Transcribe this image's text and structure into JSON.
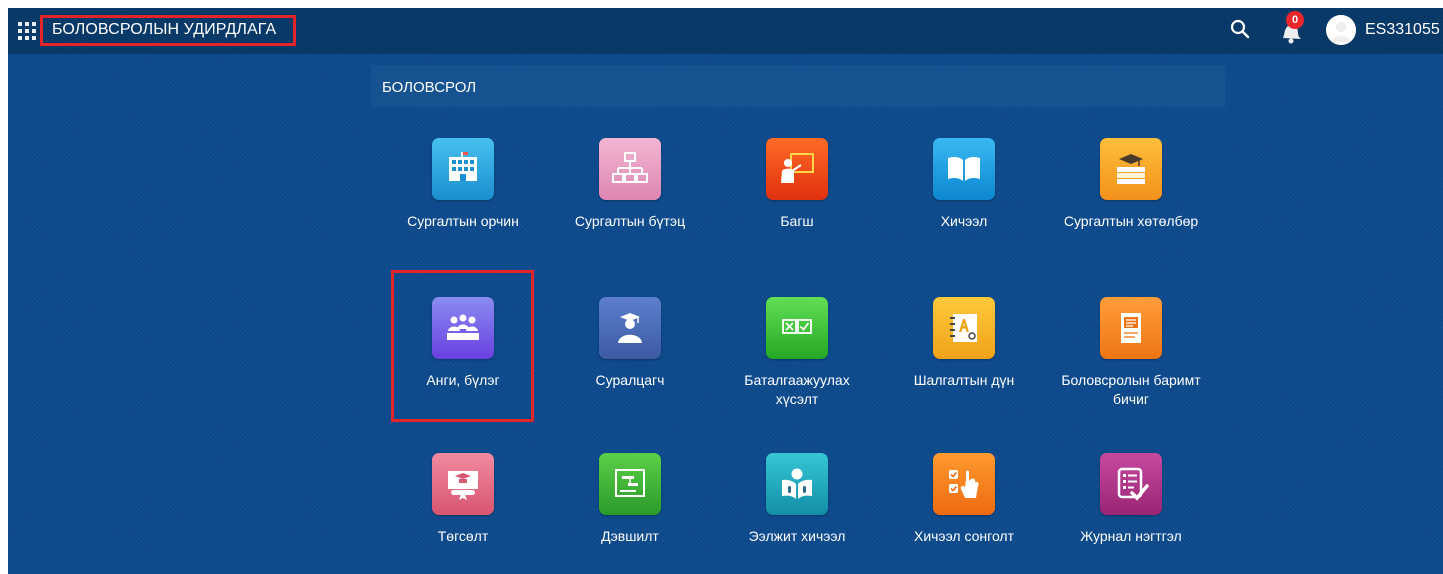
{
  "header": {
    "title": "БОЛОВСРОЛЫН УДИРДЛАГА",
    "notification_count": "0",
    "user_id": "ES331055"
  },
  "section": {
    "title": "БОЛОВСРОЛ"
  },
  "tiles": [
    {
      "label": "Сургалтын орчин",
      "icon": "building-icon",
      "color": "#2aa7e0"
    },
    {
      "label": "Сургалтын бүтэц",
      "icon": "org-chart-icon",
      "color": "#e89ac0"
    },
    {
      "label": "Багш",
      "icon": "teacher-icon",
      "color": "#f04a1e"
    },
    {
      "label": "Хичээл",
      "icon": "book-icon",
      "color": "#1ca1e4"
    },
    {
      "label": "Сургалтын хөтөлбөр",
      "icon": "stacked-books-icon",
      "color": "#f5a623"
    },
    {
      "label": "Анги, бүлэг",
      "icon": "class-group-icon",
      "color": "#7a55e0"
    },
    {
      "label": "Суралцагч",
      "icon": "student-icon",
      "color": "#4a67b8"
    },
    {
      "label": "Баталгаажуулах хүсэлт",
      "icon": "checkbox-icon",
      "color": "#3ec43a"
    },
    {
      "label": "Шалгалтын дүн",
      "icon": "grade-notebook-icon",
      "color": "#f2b31b"
    },
    {
      "label": "Боловсролын баримт бичиг",
      "icon": "document-icon",
      "color": "#f28a1d"
    },
    {
      "label": "Төгсөлт",
      "icon": "diploma-icon",
      "color": "#e0607a"
    },
    {
      "label": "Дэвшилт",
      "icon": "promotion-board-icon",
      "color": "#3bb33b"
    },
    {
      "label": "Ээлжит хичээл",
      "icon": "reading-student-icon",
      "color": "#2bb7c4"
    },
    {
      "label": "Хичээл сонголт",
      "icon": "touch-select-icon",
      "color": "#f07b1d"
    },
    {
      "label": "Журнал нэгтгэл",
      "icon": "checklist-icon",
      "color": "#b1338a"
    }
  ]
}
